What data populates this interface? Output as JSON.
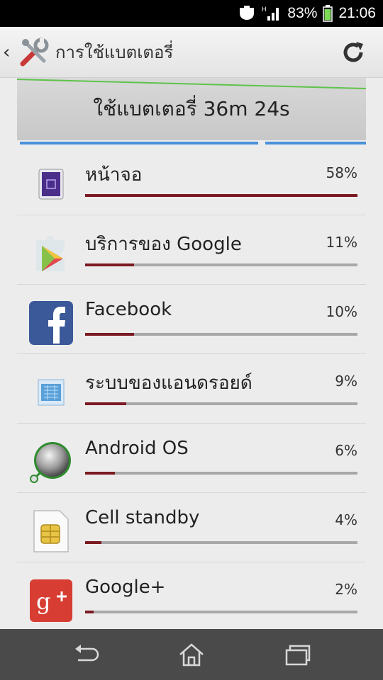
{
  "status_bar": {
    "battery_percent": "83%",
    "time": "21:06",
    "network_type": "H",
    "icons": [
      "notification-icon",
      "signal-icon",
      "battery-icon"
    ]
  },
  "header": {
    "title": "การใช้แบตเตอรี่",
    "app_icon": "tools-icon",
    "refresh_icon": "refresh-icon"
  },
  "summary": {
    "usage_text": "ใช้แบตเตอรี่ 36m 24s"
  },
  "apps": [
    {
      "name": "หน้าจอ",
      "percent": "58%",
      "fraction": 1.0,
      "icon": "screen-icon"
    },
    {
      "name": "บริการของ Google",
      "percent": "11%",
      "fraction": 0.18,
      "icon": "google-play-services-icon"
    },
    {
      "name": "Facebook",
      "percent": "10%",
      "fraction": 0.18,
      "icon": "facebook-icon"
    },
    {
      "name": "ระบบของแอนดรอยด์",
      "percent": "9%",
      "fraction": 0.15,
      "icon": "android-system-icon"
    },
    {
      "name": "Android OS",
      "percent": "6%",
      "fraction": 0.11,
      "icon": "android-os-icon"
    },
    {
      "name": "Cell standby",
      "percent": "4%",
      "fraction": 0.06,
      "icon": "sim-card-icon"
    },
    {
      "name": "Google+",
      "percent": "2%",
      "fraction": 0.03,
      "icon": "google-plus-icon"
    }
  ],
  "colors": {
    "bar_fill": "#7b1a22",
    "bar_track": "#a8a8a8",
    "graph_line": "#5ec34a",
    "graph_bar": "#4a90d9"
  },
  "nav": {
    "icons": [
      "back-icon",
      "home-icon",
      "recents-icon"
    ]
  }
}
